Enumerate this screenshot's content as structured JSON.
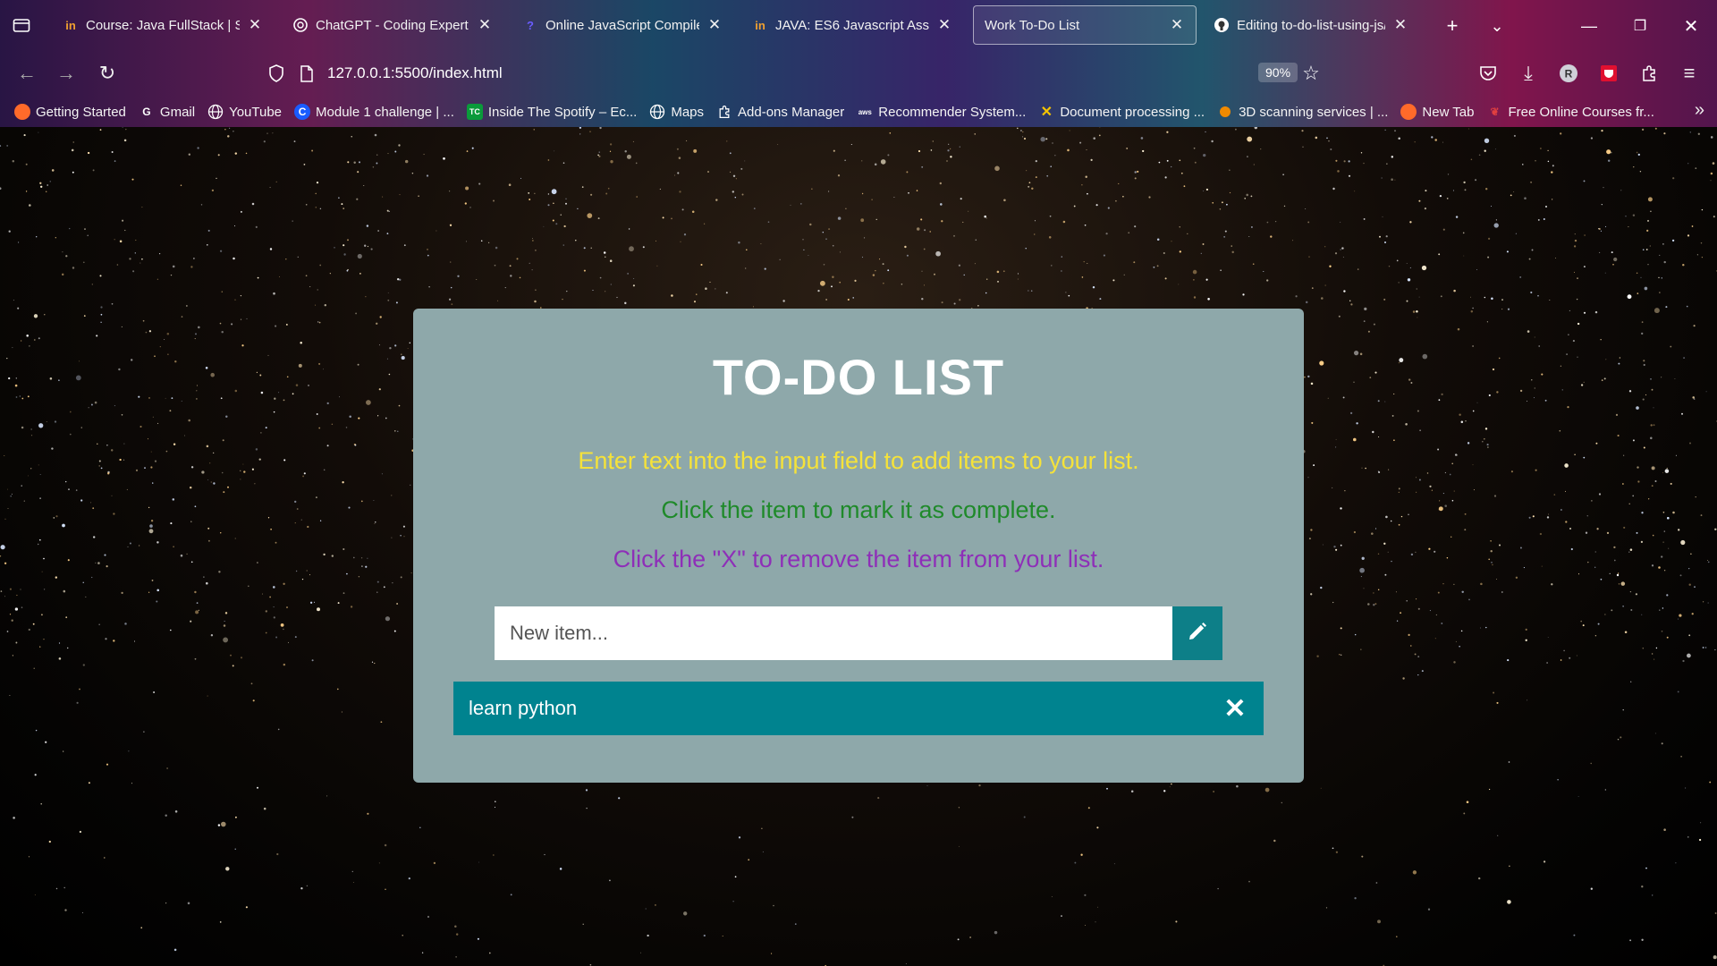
{
  "browser": {
    "tabs": [
      {
        "favicon": "in",
        "favicon_color": "#f0a030",
        "title": "Course: Java FullStack | SEC",
        "active": false
      },
      {
        "favicon": "chatgpt-icon",
        "title": "ChatGPT - Coding Expert",
        "active": false
      },
      {
        "favicon": "?",
        "favicon_color": "#6a5cff",
        "title": "Online JavaScript Compiler",
        "active": false
      },
      {
        "favicon": "in",
        "favicon_color": "#f0a030",
        "title": "JAVA: ES6 Javascript Assignm",
        "active": false
      },
      {
        "favicon": "",
        "title": "Work To-Do List",
        "active": true
      },
      {
        "favicon": "github-icon",
        "title": "Editing to-do-list-using-js/R",
        "active": false
      }
    ],
    "url": "127.0.0.1:5500/index.html",
    "zoom": "90%",
    "bookmarks": [
      {
        "icon": "firefox-icon",
        "label": "Getting Started",
        "color": "#ff6a2a"
      },
      {
        "icon": "google-icon",
        "label": "Gmail",
        "color": "#ffffff"
      },
      {
        "icon": "globe-icon",
        "label": "YouTube",
        "color": "#ffffff"
      },
      {
        "icon": "C",
        "label": "Module 1 challenge | ...",
        "color": "#1a5cff"
      },
      {
        "icon": "TC",
        "label": "Inside The Spotify – Ec...",
        "color": "#0a9a3a"
      },
      {
        "icon": "globe-icon",
        "label": "Maps",
        "color": "#ffffff"
      },
      {
        "icon": "puzzle-icon",
        "label": "Add-ons Manager",
        "color": "#ffffff"
      },
      {
        "icon": "aws",
        "label": "Recommender System...",
        "color": "#ffffff"
      },
      {
        "icon": "x-logo",
        "label": "Document processing ...",
        "color": "#f5c400"
      },
      {
        "icon": "orange-dot",
        "label": "3D scanning services | ...",
        "color": "#f08a00"
      },
      {
        "icon": "firefox-icon",
        "label": "New Tab",
        "color": "#ff6a2a"
      },
      {
        "icon": "leaf-icon",
        "label": "Free Online Courses fr...",
        "color": "#e04040"
      }
    ]
  },
  "todo": {
    "title": "TO-DO LIST",
    "instructions": [
      "Enter text into the input field to add items to your list.",
      "Click the item to mark it as complete.",
      "Click the \"X\" to remove the item from your list."
    ],
    "input_placeholder": "New item...",
    "items": [
      {
        "text": "learn python",
        "remove_label": "✕"
      }
    ],
    "colors": {
      "card": "#8ea8aa",
      "accent": "#00838f",
      "instruction_1": "#f5e23a",
      "instruction_2": "#1f8a2a",
      "instruction_3": "#8e2fb8"
    }
  }
}
